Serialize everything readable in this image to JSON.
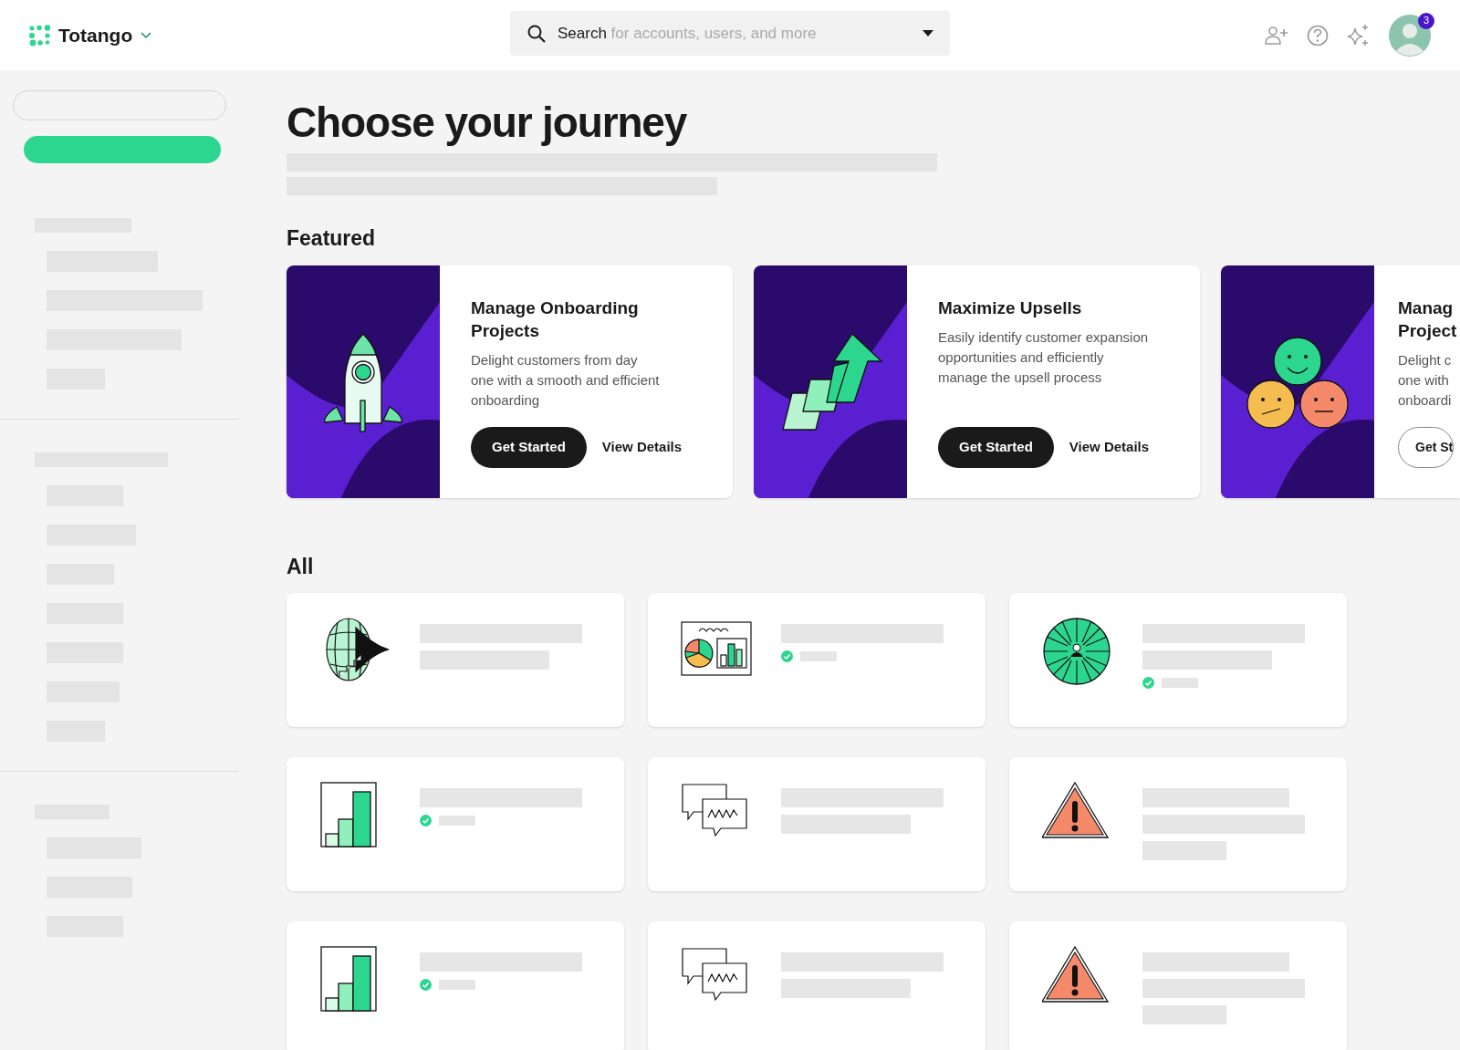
{
  "header": {
    "brand": "Totango",
    "search": {
      "label": "Search",
      "placeholder": "for accounts, users, and more"
    },
    "notifications": "3"
  },
  "page": {
    "title": "Choose your journey"
  },
  "featured": {
    "heading": "Featured",
    "cards": [
      {
        "kind": "rocket",
        "title_lines": [
          "Manage Onboarding",
          "Projects"
        ],
        "description_lines": [
          "Delight customers from day",
          "one with a smooth and efficient",
          "onboarding"
        ],
        "primary": {
          "label": "Get Started",
          "kind": "filled"
        },
        "secondary": "View Details"
      },
      {
        "kind": "arrow",
        "title_lines": [
          "Maximize Upsells"
        ],
        "description_lines": [
          "Easily identify customer expansion",
          "opportunities and efficiently",
          "manage the upsell process"
        ],
        "primary": {
          "label": "Get Started",
          "kind": "filled"
        },
        "secondary": "View Details"
      },
      {
        "kind": "faces",
        "title_lines": [
          "Manag",
          "Project"
        ],
        "description_lines": [
          "Delight c",
          "one with",
          "onboardi"
        ],
        "primary": {
          "label": "Get St",
          "kind": "outline"
        }
      }
    ]
  },
  "all": {
    "heading": "All",
    "tiles": [
      {
        "kind": "globe",
        "verified": false
      },
      {
        "kind": "dashboard",
        "verified": true
      },
      {
        "kind": "wheel",
        "verified": true
      },
      {
        "kind": "barchart",
        "verified": true
      },
      {
        "kind": "chat",
        "verified": false
      },
      {
        "kind": "warning",
        "verified": false
      },
      {
        "kind": "barchart",
        "verified": true
      },
      {
        "kind": "chat",
        "verified": false
      },
      {
        "kind": "warning",
        "verified": false
      }
    ]
  }
}
